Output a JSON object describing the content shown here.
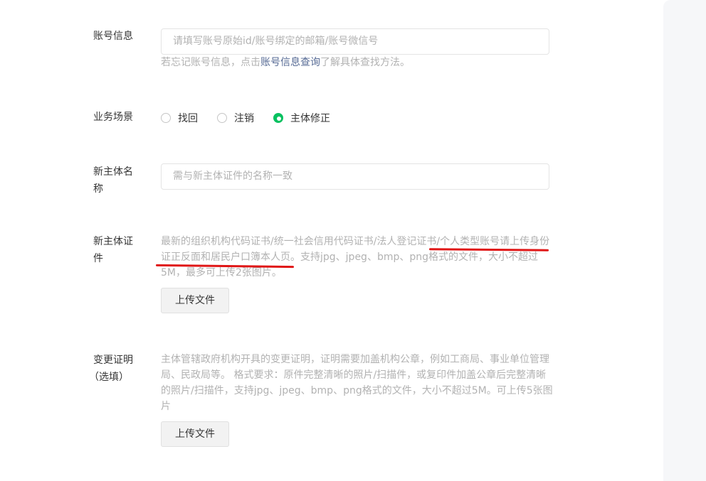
{
  "account_info": {
    "label": "账号信息",
    "placeholder": "请填写账号原始id/账号绑定的邮箱/账号微信号",
    "hint_prefix": "若忘记账号信息，点击",
    "hint_link": "账号信息查询",
    "hint_suffix": "了解具体查找方法。"
  },
  "business_scene": {
    "label": "业务场景",
    "options": [
      {
        "label": "找回",
        "checked": false
      },
      {
        "label": "注销",
        "checked": false
      },
      {
        "label": "主体修正",
        "checked": true
      }
    ]
  },
  "new_entity_name": {
    "label": "新主体名称",
    "placeholder": "需与新主体证件的名称一致"
  },
  "new_entity_cert": {
    "label": "新主体证件",
    "hint": "最新的组织机构代码证书/统一社会信用代码证书/法人登记证书/个人类型账号请上传身份证正反面和居民户口簿本人页。支持jpg、jpeg、bmp、png格式的文件，大小不超过5M，最多可上传2张图片。",
    "upload_label": "上传文件"
  },
  "change_proof": {
    "label": "变更证明",
    "label_optional": "（选填）",
    "hint": "主体管辖政府机构开具的变更证明，证明需要加盖机构公章，例如工商局、事业单位管理局、民政局等。 格式要求：原件完整清晰的照片/扫描件，或复印件加盖公章后完整清晰的照片/扫描件，支持jpg、jpeg、bmp、png格式的文件，大小不超过5M。可上传5张图片",
    "upload_label": "上传文件"
  },
  "colors": {
    "accent": "#07c160",
    "link": "#576b95",
    "annotation": "#e01616"
  }
}
